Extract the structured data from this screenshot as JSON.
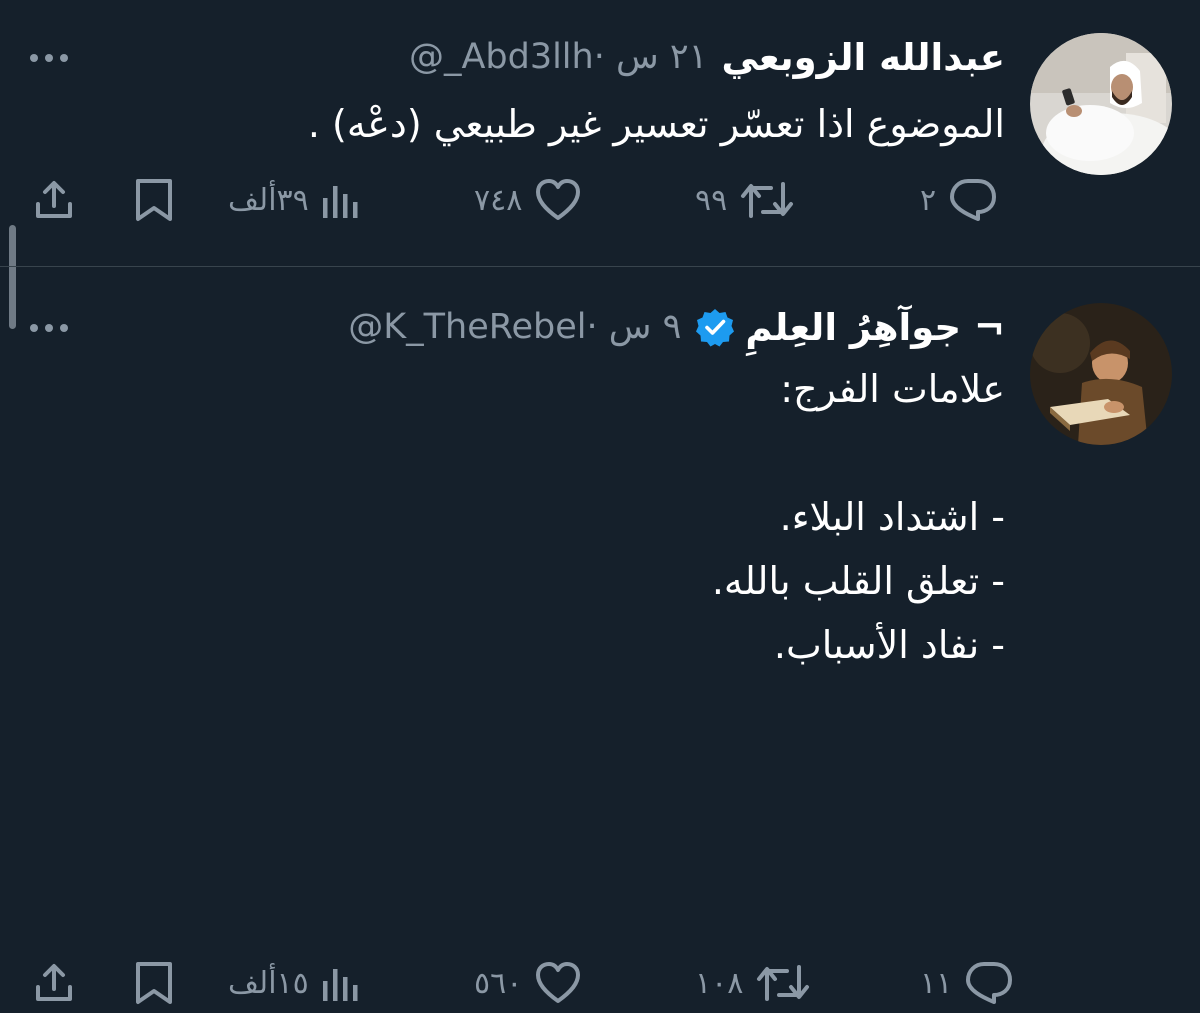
{
  "theme": {
    "background": "#15202b",
    "text": "#ffffff",
    "muted": "#8b98a5",
    "verified": "#1d9bf0",
    "divider": "#38444d"
  },
  "tweets": [
    {
      "display_name": "عبدالله الزوبعي",
      "meta": "@_Abd3llh· ٢١ س",
      "verified": false,
      "text": "الموضوع اذا تعسّر تعسير غير طبيعي (دعْه) .",
      "actions": {
        "reply": "٢",
        "retweet": "٩٩",
        "like": "٧٤٨",
        "views": "٣٩ألف"
      },
      "icons": {
        "more": "more-icon",
        "reply": "reply-icon",
        "retweet": "retweet-icon",
        "like": "heart-icon",
        "views": "views-icon",
        "bookmark": "bookmark-icon",
        "share": "share-icon"
      }
    },
    {
      "display_name": "جوآهِرُ العِلمِ ¬",
      "meta": "@K_TheRebel· ٩ س",
      "verified": true,
      "text": "علامات الفرج:\n\n- اشتداد البلاء.\n- تعلق القلب بالله.\n- نفاد الأسباب.",
      "actions": {
        "reply": "١١",
        "retweet": "١٠٨",
        "like": "٥٦٠",
        "views": "١٥ألف"
      },
      "icons": {
        "more": "more-icon",
        "reply": "reply-icon",
        "retweet": "retweet-icon",
        "like": "heart-icon",
        "views": "views-icon",
        "bookmark": "bookmark-icon",
        "share": "share-icon"
      }
    }
  ]
}
